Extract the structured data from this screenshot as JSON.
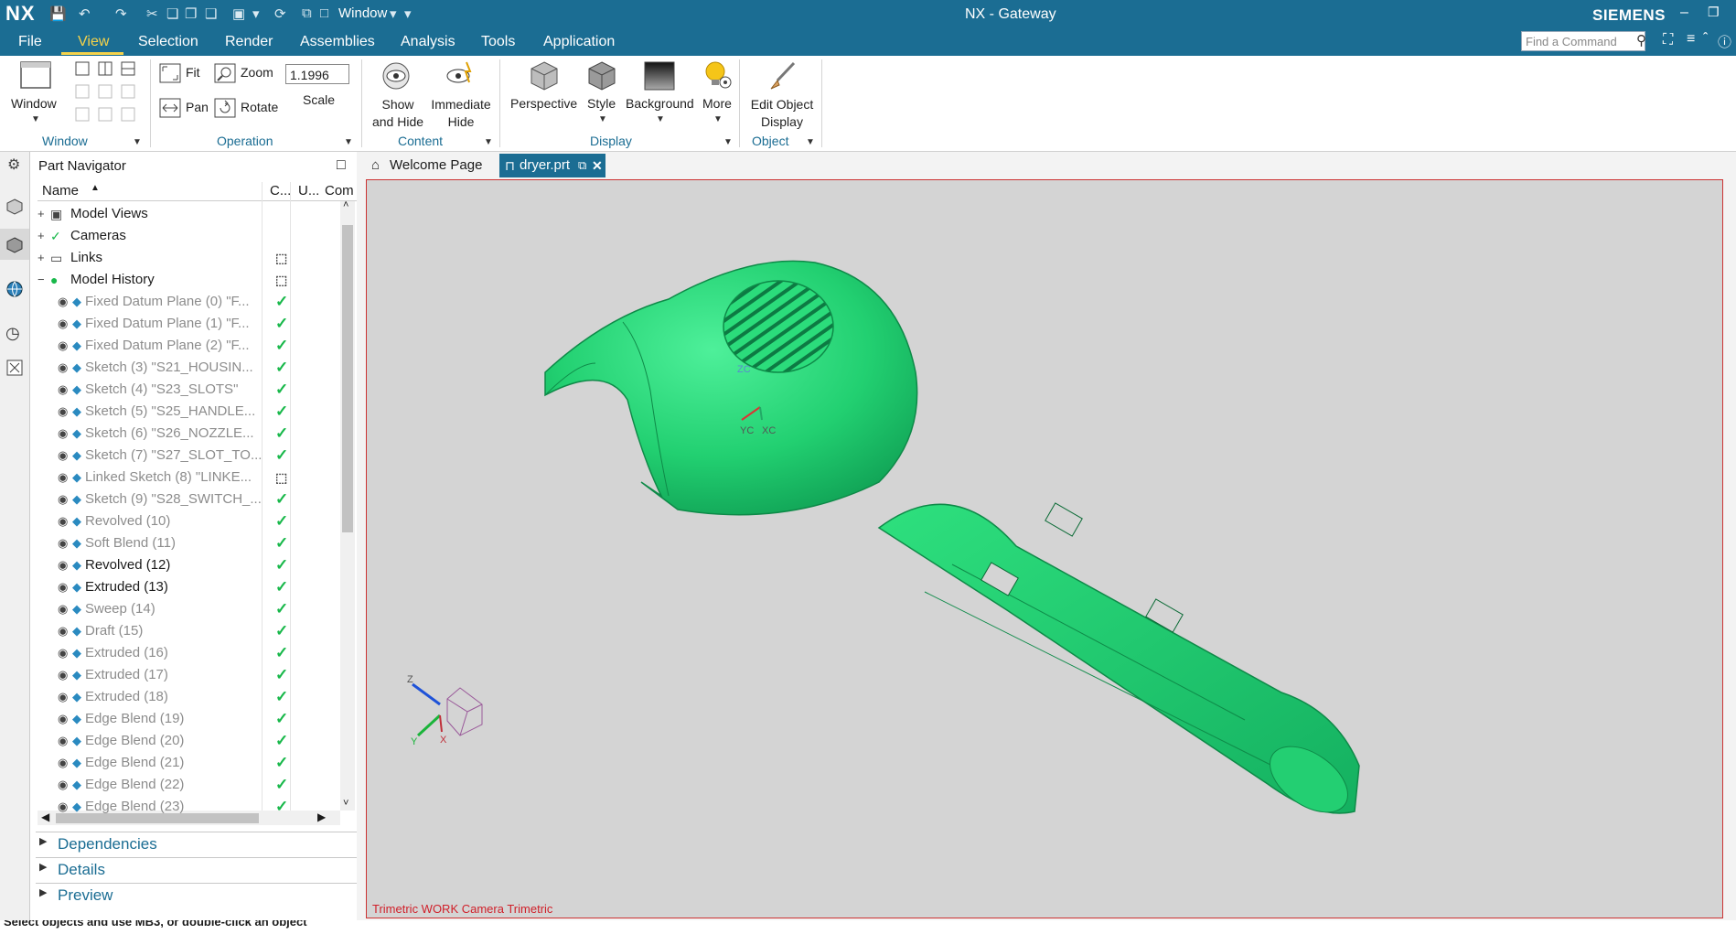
{
  "titlebar": {
    "logo": "NX",
    "window_menu": "Window",
    "title": "NX - Gateway",
    "brand": "SIEMENS"
  },
  "menubar": {
    "items": [
      "File",
      "View",
      "Selection",
      "Render",
      "Assemblies",
      "Analysis",
      "Tools",
      "Application"
    ],
    "active": "View",
    "find_command_placeholder": "Find a Command"
  },
  "ribbon": {
    "window_group": {
      "button": "Window",
      "label": "Window"
    },
    "operation_group": {
      "fit": "Fit",
      "zoom": "Zoom",
      "pan": "Pan",
      "rotate": "Rotate",
      "scale_value": "1.1996",
      "scale_label": "Scale",
      "label": "Operation"
    },
    "content_group": {
      "show_hide": "Show and Hide",
      "immediate_hide": "Immediate Hide",
      "label": "Content"
    },
    "display_group": {
      "perspective": "Perspective",
      "style": "Style",
      "background": "Background",
      "more": "More",
      "label": "Display"
    },
    "object_group": {
      "edit_object_display": "Edit Object Display",
      "label": "Object"
    }
  },
  "navigator": {
    "title": "Part Navigator",
    "columns": [
      "Name",
      "C...",
      "U...",
      "Com"
    ],
    "rows": [
      {
        "label": "Model Views",
        "level": 0,
        "dim": false,
        "status": ""
      },
      {
        "label": "Cameras",
        "level": 0,
        "dim": false,
        "status": ""
      },
      {
        "label": "Links",
        "level": 0,
        "dim": false,
        "status": "link"
      },
      {
        "label": "Model History",
        "level": 0,
        "dim": false,
        "status": "link"
      },
      {
        "label": "Fixed Datum Plane (0) \"F...",
        "level": 1,
        "dim": true,
        "status": "check"
      },
      {
        "label": "Fixed Datum Plane (1) \"F...",
        "level": 1,
        "dim": true,
        "status": "check"
      },
      {
        "label": "Fixed Datum Plane (2) \"F...",
        "level": 1,
        "dim": true,
        "status": "check"
      },
      {
        "label": "Sketch (3) \"S21_HOUSIN...",
        "level": 1,
        "dim": true,
        "status": "check"
      },
      {
        "label": "Sketch (4) \"S23_SLOTS\"",
        "level": 1,
        "dim": true,
        "status": "check"
      },
      {
        "label": "Sketch (5) \"S25_HANDLE...",
        "level": 1,
        "dim": true,
        "status": "check"
      },
      {
        "label": "Sketch (6) \"S26_NOZZLE...",
        "level": 1,
        "dim": true,
        "status": "check"
      },
      {
        "label": "Sketch (7) \"S27_SLOT_TO...",
        "level": 1,
        "dim": true,
        "status": "check"
      },
      {
        "label": "Linked Sketch (8) \"LINKE...",
        "level": 1,
        "dim": true,
        "status": "link"
      },
      {
        "label": "Sketch (9) \"S28_SWITCH_...",
        "level": 1,
        "dim": true,
        "status": "check"
      },
      {
        "label": "Revolved (10)",
        "level": 1,
        "dim": true,
        "status": "check"
      },
      {
        "label": "Soft Blend (11)",
        "level": 1,
        "dim": true,
        "status": "check"
      },
      {
        "label": "Revolved (12)",
        "level": 1,
        "dim": false,
        "status": "check"
      },
      {
        "label": "Extruded (13)",
        "level": 1,
        "dim": false,
        "status": "check"
      },
      {
        "label": "Sweep (14)",
        "level": 1,
        "dim": true,
        "status": "check"
      },
      {
        "label": "Draft (15)",
        "level": 1,
        "dim": true,
        "status": "check"
      },
      {
        "label": "Extruded (16)",
        "level": 1,
        "dim": true,
        "status": "check"
      },
      {
        "label": "Extruded (17)",
        "level": 1,
        "dim": true,
        "status": "check"
      },
      {
        "label": "Extruded (18)",
        "level": 1,
        "dim": true,
        "status": "check"
      },
      {
        "label": "Edge Blend (19)",
        "level": 1,
        "dim": true,
        "status": "check"
      },
      {
        "label": "Edge Blend (20)",
        "level": 1,
        "dim": true,
        "status": "check"
      },
      {
        "label": "Edge Blend (21)",
        "level": 1,
        "dim": true,
        "status": "check"
      },
      {
        "label": "Edge Blend (22)",
        "level": 1,
        "dim": true,
        "status": "check"
      },
      {
        "label": "Edge Blend (23)",
        "level": 1,
        "dim": true,
        "status": "check"
      }
    ],
    "panels": [
      "Dependencies",
      "Details",
      "Preview"
    ]
  },
  "tabs": [
    {
      "label": "Welcome Page",
      "active": false
    },
    {
      "label": "dryer.prt",
      "active": true
    }
  ],
  "viewport": {
    "caption": "Trimetric WORK Camera Trimetric",
    "csys_labels": {
      "yc": "YC",
      "xc": "XC",
      "zc": "ZC",
      "z": "Z",
      "y": "Y",
      "x": "X"
    },
    "model_color": "#27d874"
  },
  "status": {
    "text": "Select objects and use MB3, or double-click an object"
  },
  "colors": {
    "titlebar": "#1b6d93",
    "accent": "#f5d24a",
    "check": "#18b84a"
  }
}
